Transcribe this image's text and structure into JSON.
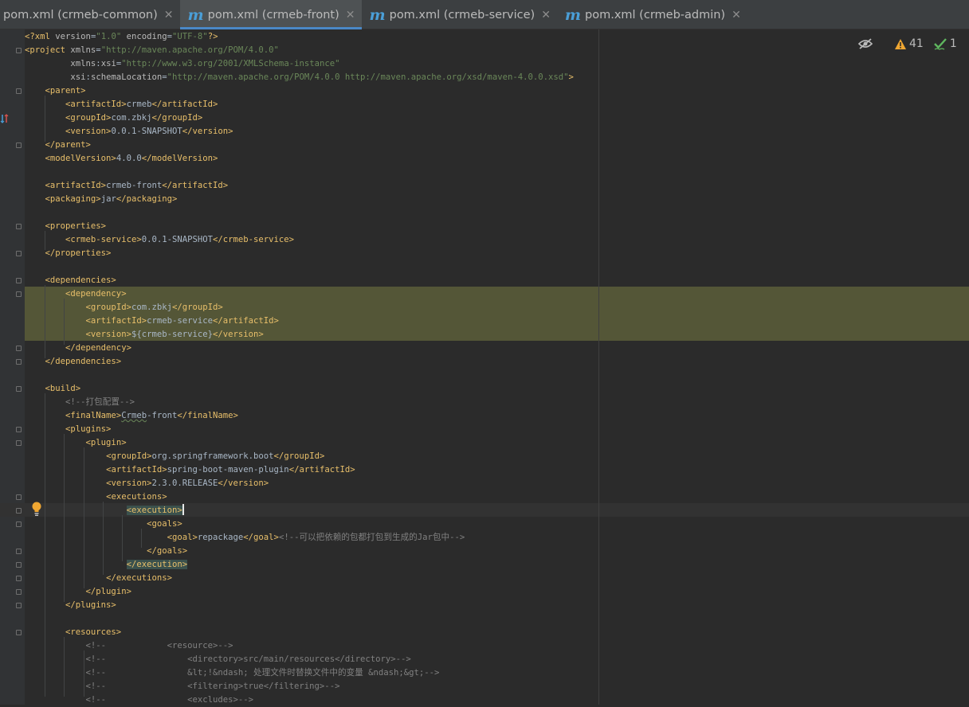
{
  "tabs": [
    {
      "label": "pom.xml (crmeb-common)",
      "icon": "",
      "active": false
    },
    {
      "label": "pom.xml (crmeb-front)",
      "icon": "m",
      "active": true
    },
    {
      "label": "pom.xml (crmeb-service)",
      "icon": "m",
      "active": false
    },
    {
      "label": "pom.xml (crmeb-admin)",
      "icon": "m",
      "active": false
    }
  ],
  "status": {
    "warnings": "41",
    "ok": "1"
  },
  "colors": {
    "tag": "#e8bf6a",
    "attr": "#bababa",
    "string": "#6a8759",
    "comment": "#808080",
    "text": "#a9b7c6",
    "accent": "#4a88c7"
  },
  "code": [
    {
      "indent": 0,
      "segs": [
        [
          "t",
          "<?xml "
        ],
        [
          "n",
          "version"
        ],
        [
          "txt",
          "="
        ],
        [
          "s",
          "\"1.0\""
        ],
        [
          "txt",
          " "
        ],
        [
          "n",
          "encoding"
        ],
        [
          "txt",
          "="
        ],
        [
          "s",
          "\"UTF-8\""
        ],
        [
          "t",
          "?>"
        ]
      ]
    },
    {
      "indent": 0,
      "segs": [
        [
          "t",
          "<project "
        ],
        [
          "n",
          "xmlns"
        ],
        [
          "txt",
          "="
        ],
        [
          "s",
          "\"http://maven.apache.org/POM/4.0.0\""
        ]
      ]
    },
    {
      "indent": 9,
      "segs": [
        [
          "n",
          "xmlns"
        ],
        [
          "txt",
          ":"
        ],
        [
          "n",
          "xsi"
        ],
        [
          "txt",
          "="
        ],
        [
          "s",
          "\"http://www.w3.org/2001/XMLSchema-instance\""
        ]
      ]
    },
    {
      "indent": 9,
      "segs": [
        [
          "n",
          "xsi"
        ],
        [
          "txt",
          ":"
        ],
        [
          "n",
          "schemaLocation"
        ],
        [
          "txt",
          "="
        ],
        [
          "s",
          "\"http://maven.apache.org/POM/4.0.0 http://maven.apache.org/xsd/maven-4.0.0.xsd\""
        ],
        [
          "t",
          ">"
        ]
      ]
    },
    {
      "indent": 4,
      "segs": [
        [
          "t",
          "<parent>"
        ]
      ]
    },
    {
      "indent": 8,
      "segs": [
        [
          "t",
          "<artifactId>"
        ],
        [
          "txt",
          "crmeb"
        ],
        [
          "t",
          "</artifactId>"
        ]
      ]
    },
    {
      "indent": 8,
      "segs": [
        [
          "t",
          "<groupId>"
        ],
        [
          "txt",
          "com.zbkj"
        ],
        [
          "t",
          "</groupId>"
        ]
      ]
    },
    {
      "indent": 8,
      "segs": [
        [
          "t",
          "<version>"
        ],
        [
          "txt",
          "0.0.1-SNAPSHOT"
        ],
        [
          "t",
          "</version>"
        ]
      ]
    },
    {
      "indent": 4,
      "segs": [
        [
          "t",
          "</parent>"
        ]
      ]
    },
    {
      "indent": 4,
      "segs": [
        [
          "t",
          "<modelVersion>"
        ],
        [
          "txt",
          "4.0.0"
        ],
        [
          "t",
          "</modelVersion>"
        ]
      ]
    },
    {
      "indent": 0,
      "segs": []
    },
    {
      "indent": 4,
      "segs": [
        [
          "t",
          "<artifactId>"
        ],
        [
          "txt",
          "crmeb-front"
        ],
        [
          "t",
          "</artifactId>"
        ]
      ]
    },
    {
      "indent": 4,
      "segs": [
        [
          "t",
          "<packaging>"
        ],
        [
          "txt",
          "jar"
        ],
        [
          "t",
          "</packaging>"
        ]
      ]
    },
    {
      "indent": 0,
      "segs": []
    },
    {
      "indent": 4,
      "segs": [
        [
          "t",
          "<properties>"
        ]
      ]
    },
    {
      "indent": 8,
      "segs": [
        [
          "t",
          "<crmeb-service>"
        ],
        [
          "txt",
          "0.0.1-SNAPSHOT"
        ],
        [
          "t",
          "</crmeb-service>"
        ]
      ]
    },
    {
      "indent": 4,
      "segs": [
        [
          "t",
          "</properties>"
        ]
      ]
    },
    {
      "indent": 0,
      "segs": []
    },
    {
      "indent": 4,
      "segs": [
        [
          "t",
          "<dependencies>"
        ]
      ]
    },
    {
      "indent": 8,
      "segs": [
        [
          "t",
          "<dependency>"
        ]
      ]
    },
    {
      "indent": 12,
      "segs": [
        [
          "t",
          "<groupId>"
        ],
        [
          "txt",
          "com.zbkj"
        ],
        [
          "t",
          "</groupId>"
        ]
      ]
    },
    {
      "indent": 12,
      "segs": [
        [
          "t",
          "<artifactId>"
        ],
        [
          "txt",
          "crmeb-service"
        ],
        [
          "t",
          "</artifactId>"
        ]
      ]
    },
    {
      "indent": 12,
      "segs": [
        [
          "t",
          "<version>"
        ],
        [
          "txt",
          "${crmeb-service}"
        ],
        [
          "t",
          "</version>"
        ]
      ]
    },
    {
      "indent": 8,
      "segs": [
        [
          "t",
          "</dependency>"
        ]
      ]
    },
    {
      "indent": 4,
      "segs": [
        [
          "t",
          "</dependencies>"
        ]
      ]
    },
    {
      "indent": 0,
      "segs": []
    },
    {
      "indent": 4,
      "segs": [
        [
          "t",
          "<build>"
        ]
      ]
    },
    {
      "indent": 8,
      "segs": [
        [
          "c",
          "<!--打包配置-->"
        ]
      ]
    },
    {
      "indent": 8,
      "segs": [
        [
          "t",
          "<finalName>"
        ],
        [
          "ul",
          "Crmeb"
        ],
        [
          "txt",
          "-front"
        ],
        [
          "t",
          "</finalName>"
        ]
      ]
    },
    {
      "indent": 8,
      "segs": [
        [
          "t",
          "<plugins>"
        ]
      ]
    },
    {
      "indent": 12,
      "segs": [
        [
          "t",
          "<plugin>"
        ]
      ]
    },
    {
      "indent": 16,
      "segs": [
        [
          "t",
          "<groupId>"
        ],
        [
          "txt",
          "org.springframework.boot"
        ],
        [
          "t",
          "</groupId>"
        ]
      ]
    },
    {
      "indent": 16,
      "segs": [
        [
          "t",
          "<artifactId>"
        ],
        [
          "txt",
          "spring-boot-maven-plugin"
        ],
        [
          "t",
          "</artifactId>"
        ]
      ]
    },
    {
      "indent": 16,
      "segs": [
        [
          "t",
          "<version>"
        ],
        [
          "txt",
          "2.3.0.RELEASE"
        ],
        [
          "t",
          "</version>"
        ]
      ]
    },
    {
      "indent": 16,
      "segs": [
        [
          "t",
          "<executions>"
        ]
      ]
    },
    {
      "indent": 20,
      "segs": [
        [
          "sel",
          "<execution>"
        ],
        [
          "caret",
          ""
        ]
      ]
    },
    {
      "indent": 24,
      "segs": [
        [
          "t",
          "<goals>"
        ]
      ]
    },
    {
      "indent": 28,
      "segs": [
        [
          "t",
          "<goal>"
        ],
        [
          "txt",
          "repackage"
        ],
        [
          "t",
          "</goal>"
        ],
        [
          "c",
          "<!--可以把依赖的包都打包到生成的Jar包中-->"
        ]
      ]
    },
    {
      "indent": 24,
      "segs": [
        [
          "t",
          "</goals>"
        ]
      ]
    },
    {
      "indent": 20,
      "segs": [
        [
          "sel",
          "</execution>"
        ]
      ]
    },
    {
      "indent": 16,
      "segs": [
        [
          "t",
          "</executions>"
        ]
      ]
    },
    {
      "indent": 12,
      "segs": [
        [
          "t",
          "</plugin>"
        ]
      ]
    },
    {
      "indent": 8,
      "segs": [
        [
          "t",
          "</plugins>"
        ]
      ]
    },
    {
      "indent": 0,
      "segs": []
    },
    {
      "indent": 8,
      "segs": [
        [
          "t",
          "<resources>"
        ]
      ]
    },
    {
      "indent": 12,
      "segs": [
        [
          "c",
          "<!--            <resource>-->"
        ]
      ]
    },
    {
      "indent": 12,
      "segs": [
        [
          "c",
          "<!--                <directory>src/main/resources</directory>-->"
        ]
      ]
    },
    {
      "indent": 12,
      "segs": [
        [
          "c",
          "<!--                &lt;!&ndash; 处理文件时替换文件中的变量 &ndash;&gt;-->"
        ]
      ]
    },
    {
      "indent": 12,
      "segs": [
        [
          "c",
          "<!--                <filtering>true</filtering>-->"
        ]
      ]
    },
    {
      "indent": 12,
      "segs": [
        [
          "c",
          "<!--                <excludes>-->"
        ]
      ]
    }
  ]
}
